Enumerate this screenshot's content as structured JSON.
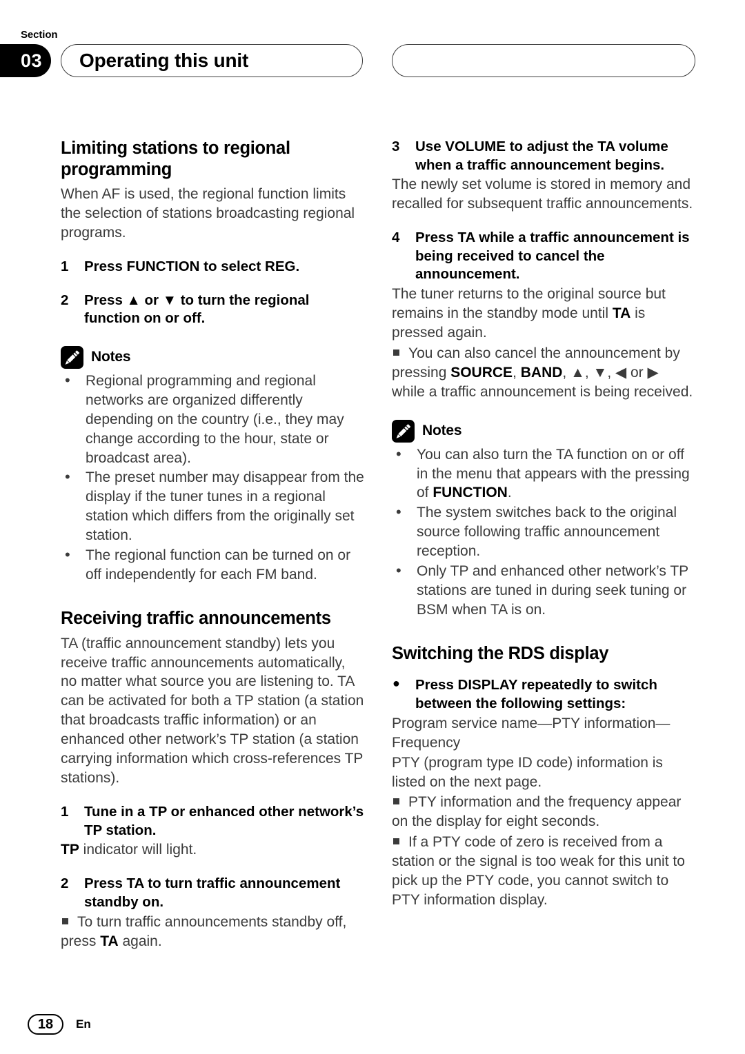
{
  "header": {
    "section_word": "Section",
    "section_number": "03",
    "title": "Operating this unit"
  },
  "footer": {
    "page_number": "18",
    "language": "En"
  },
  "left_column": {
    "heading_1": "Limiting stations to regional programming",
    "intro_1": "When AF is used, the regional function limits the selection of stations broadcasting regional programs.",
    "step_1_num": "1",
    "step_1_text": "Press FUNCTION to select REG.",
    "step_2_num": "2",
    "step_2_text": "Press ▲ or ▼ to turn the regional function on or off.",
    "notes_label": "Notes",
    "notes": [
      "Regional programming and regional networks are organized differently depending on the country (i.e., they may change according to the hour, state or broadcast area).",
      "The preset number may disappear from the display if the tuner tunes in a regional station which differs from the originally set station.",
      "The regional function can be turned on or off independently for each FM band."
    ],
    "heading_2": "Receiving traffic announcements",
    "intro_2": "TA (traffic announcement standby) lets you receive traffic announcements automatically, no matter what source you are listening to. TA can be activated for both a TP station (a station that broadcasts traffic information) or an enhanced other network’s TP station (a station carrying information which cross-references TP stations).",
    "step_3_num": "1",
    "step_3_text": "Tune in a TP or enhanced other network’s TP station.",
    "step_3_sub_bold": "TP",
    "step_3_sub_rest": " indicator will light.",
    "step_4_num": "2",
    "step_4_text": "Press TA to turn traffic announcement standby on.",
    "step_4_note_a": "To turn traffic announcements standby off, press ",
    "step_4_note_b": "TA",
    "step_4_note_c": " again."
  },
  "right_column": {
    "step_5_num": "3",
    "step_5_text": "Use VOLUME to adjust the TA volume when a traffic announcement begins.",
    "step_5_sub": "The newly set volume is stored in memory and recalled for subsequent traffic announcements.",
    "step_6_num": "4",
    "step_6_text": "Press TA while a traffic announcement is being received to cancel the announcement.",
    "step_6_sub_a": "The tuner returns to the original source but remains in the standby mode until ",
    "step_6_sub_b": "TA",
    "step_6_sub_c": " is pressed again.",
    "step_6_note_a": "You can also cancel the announcement by pressing ",
    "step_6_note_source": "SOURCE",
    "step_6_note_b": ", ",
    "step_6_note_band": "BAND",
    "step_6_note_c": ", ▲, ▼, ◀ or ▶ while a traffic announcement is being received.",
    "notes_label": "Notes",
    "note_1_a": "You can also turn the TA function on or off in the menu that appears with the pressing of ",
    "note_1_bold": "FUNCTION",
    "note_1_b": ".",
    "note_2": "The system switches back to the original source following traffic announcement reception.",
    "note_3": "Only TP and enhanced other network’s TP stations are tuned in during seek tuning or BSM when TA is on.",
    "heading_3": "Switching the RDS display",
    "step_7_text": "Press DISPLAY repeatedly to switch between the following settings:",
    "step_7_sub_1": "Program service name—PTY information—Frequency",
    "step_7_sub_2": "PTY (program type ID code) information is listed on the next page.",
    "step_7_note_1": "PTY information and the frequency appear on the display for eight seconds.",
    "step_7_note_2": "If a PTY code of zero is received from a station or the signal is too weak for this unit to pick up the PTY code, you cannot switch to PTY information display."
  },
  "colors": {
    "ink": "#231f20",
    "body_text": "#3b3b3b",
    "accent_black": "#000000"
  }
}
